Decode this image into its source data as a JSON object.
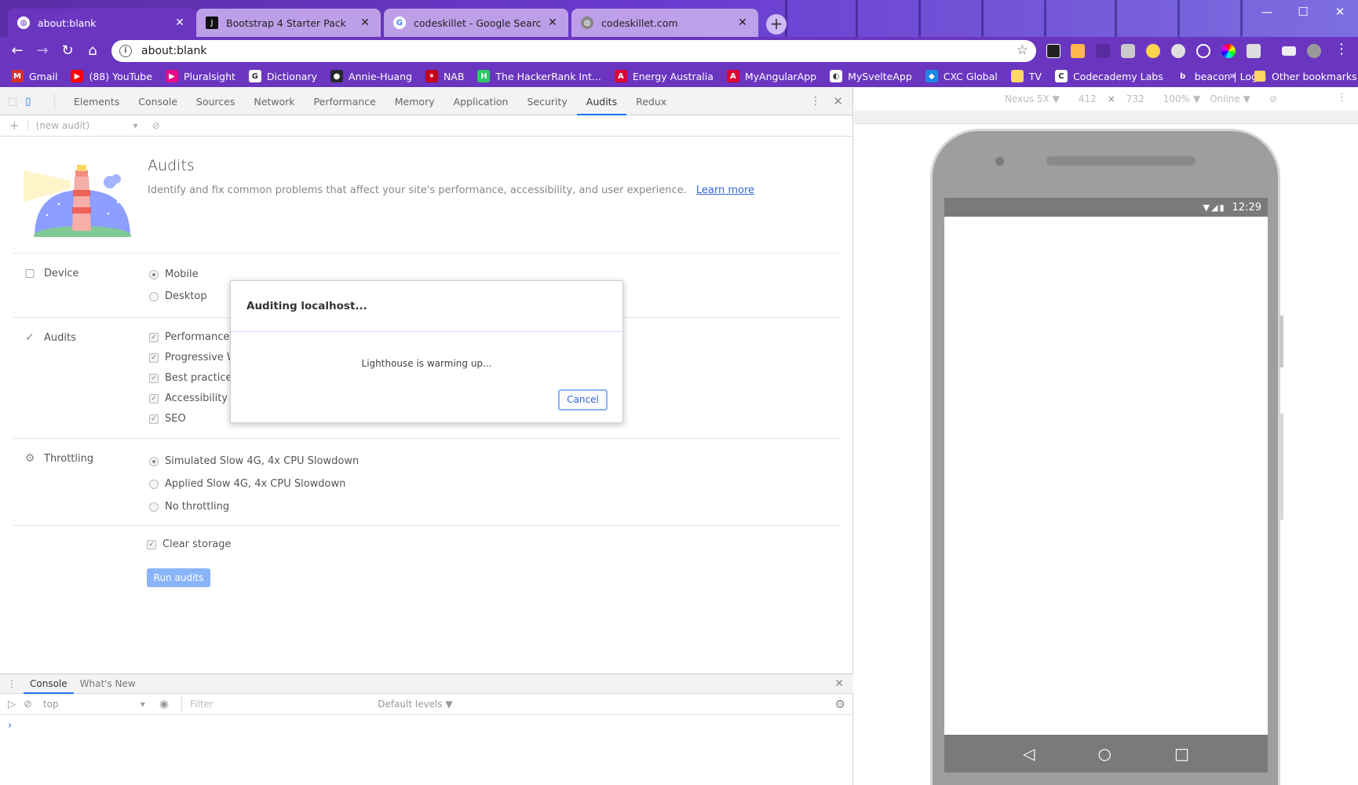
{
  "browser": {
    "tabs": [
      {
        "title": "about:blank",
        "active": true,
        "icon": "globe-icon"
      },
      {
        "title": "Bootstrap 4 Starter Pack",
        "active": false,
        "icon": "jetbrains-icon"
      },
      {
        "title": "codeskillet - Google Search",
        "active": false,
        "icon": "google-icon"
      },
      {
        "title": "codeskillet.com",
        "active": false,
        "icon": "globe-icon"
      }
    ],
    "address": "about:blank"
  },
  "bookmarks": {
    "items": [
      {
        "label": "Gmail",
        "color": "#d93025",
        "glyph": "M"
      },
      {
        "label": "(88) YouTube",
        "color": "#ff0000",
        "glyph": "▶"
      },
      {
        "label": "Pluralsight",
        "color": "#e80a89",
        "glyph": "▶"
      },
      {
        "label": "Dictionary",
        "color": "#ffffff",
        "glyph": "G"
      },
      {
        "label": "Annie-Huang",
        "color": "#24292e",
        "glyph": "●"
      },
      {
        "label": "NAB",
        "color": "#c4001a",
        "glyph": "✶"
      },
      {
        "label": "The HackerRank Int...",
        "color": "#2ec866",
        "glyph": "H"
      },
      {
        "label": "Energy Australia",
        "color": "#dd0031",
        "glyph": "A"
      },
      {
        "label": "MyAngularApp",
        "color": "#dd0031",
        "glyph": "A"
      },
      {
        "label": "MySvelteApp",
        "color": "#ffffff",
        "glyph": "◐"
      },
      {
        "label": "CXC Global",
        "color": "#1e88e5",
        "glyph": "◆"
      },
      {
        "label": "TV",
        "color": "#fdd663",
        "glyph": ""
      },
      {
        "label": "Codecademy Labs",
        "color": "#ffffff",
        "glyph": "C"
      },
      {
        "label": "beacon | Login",
        "color": "#6a36c0",
        "glyph": "b"
      }
    ],
    "more": "»",
    "other": "Other bookmarks"
  },
  "devtools": {
    "tabs": [
      "Elements",
      "Console",
      "Sources",
      "Network",
      "Performance",
      "Memory",
      "Application",
      "Security",
      "Audits",
      "Redux"
    ],
    "active_tab": "Audits",
    "audit_select": "(new audit)",
    "audits": {
      "title": "Audits",
      "description": "Identify and fix common problems that affect your site's performance, accessibility, and user experience.",
      "learn_more": "Learn more",
      "device": {
        "label": "Device",
        "options": [
          {
            "label": "Mobile",
            "selected": true
          },
          {
            "label": "Desktop",
            "selected": false
          }
        ]
      },
      "categories": {
        "label": "Audits",
        "options": [
          {
            "label": "Performance",
            "checked": true
          },
          {
            "label": "Progressive We",
            "checked": true
          },
          {
            "label": "Best practices",
            "checked": true
          },
          {
            "label": "Accessibility",
            "checked": true
          },
          {
            "label": "SEO",
            "checked": true
          }
        ]
      },
      "throttling": {
        "label": "Throttling",
        "options": [
          {
            "label": "Simulated Slow 4G, 4x CPU Slowdown",
            "selected": true
          },
          {
            "label": "Applied Slow 4G, 4x CPU Slowdown",
            "selected": false
          },
          {
            "label": "No throttling",
            "selected": false
          }
        ]
      },
      "clear_storage": {
        "label": "Clear storage",
        "checked": true
      },
      "run_button": "Run audits"
    },
    "dialog": {
      "title": "Auditing localhost...",
      "status": "Lighthouse is warming up...",
      "cancel": "Cancel"
    },
    "drawer": {
      "tabs": [
        "Console",
        "What's New"
      ],
      "active_tab": "Console",
      "context": "top",
      "filter_placeholder": "Filter",
      "levels": "Default levels ▼",
      "prompt": "›"
    }
  },
  "emulation": {
    "device": "Nexus 5X ▼",
    "width": "412",
    "times": "×",
    "height": "732",
    "zoom": "100% ▼",
    "network": "Online ▼",
    "status_time": "12:29"
  }
}
